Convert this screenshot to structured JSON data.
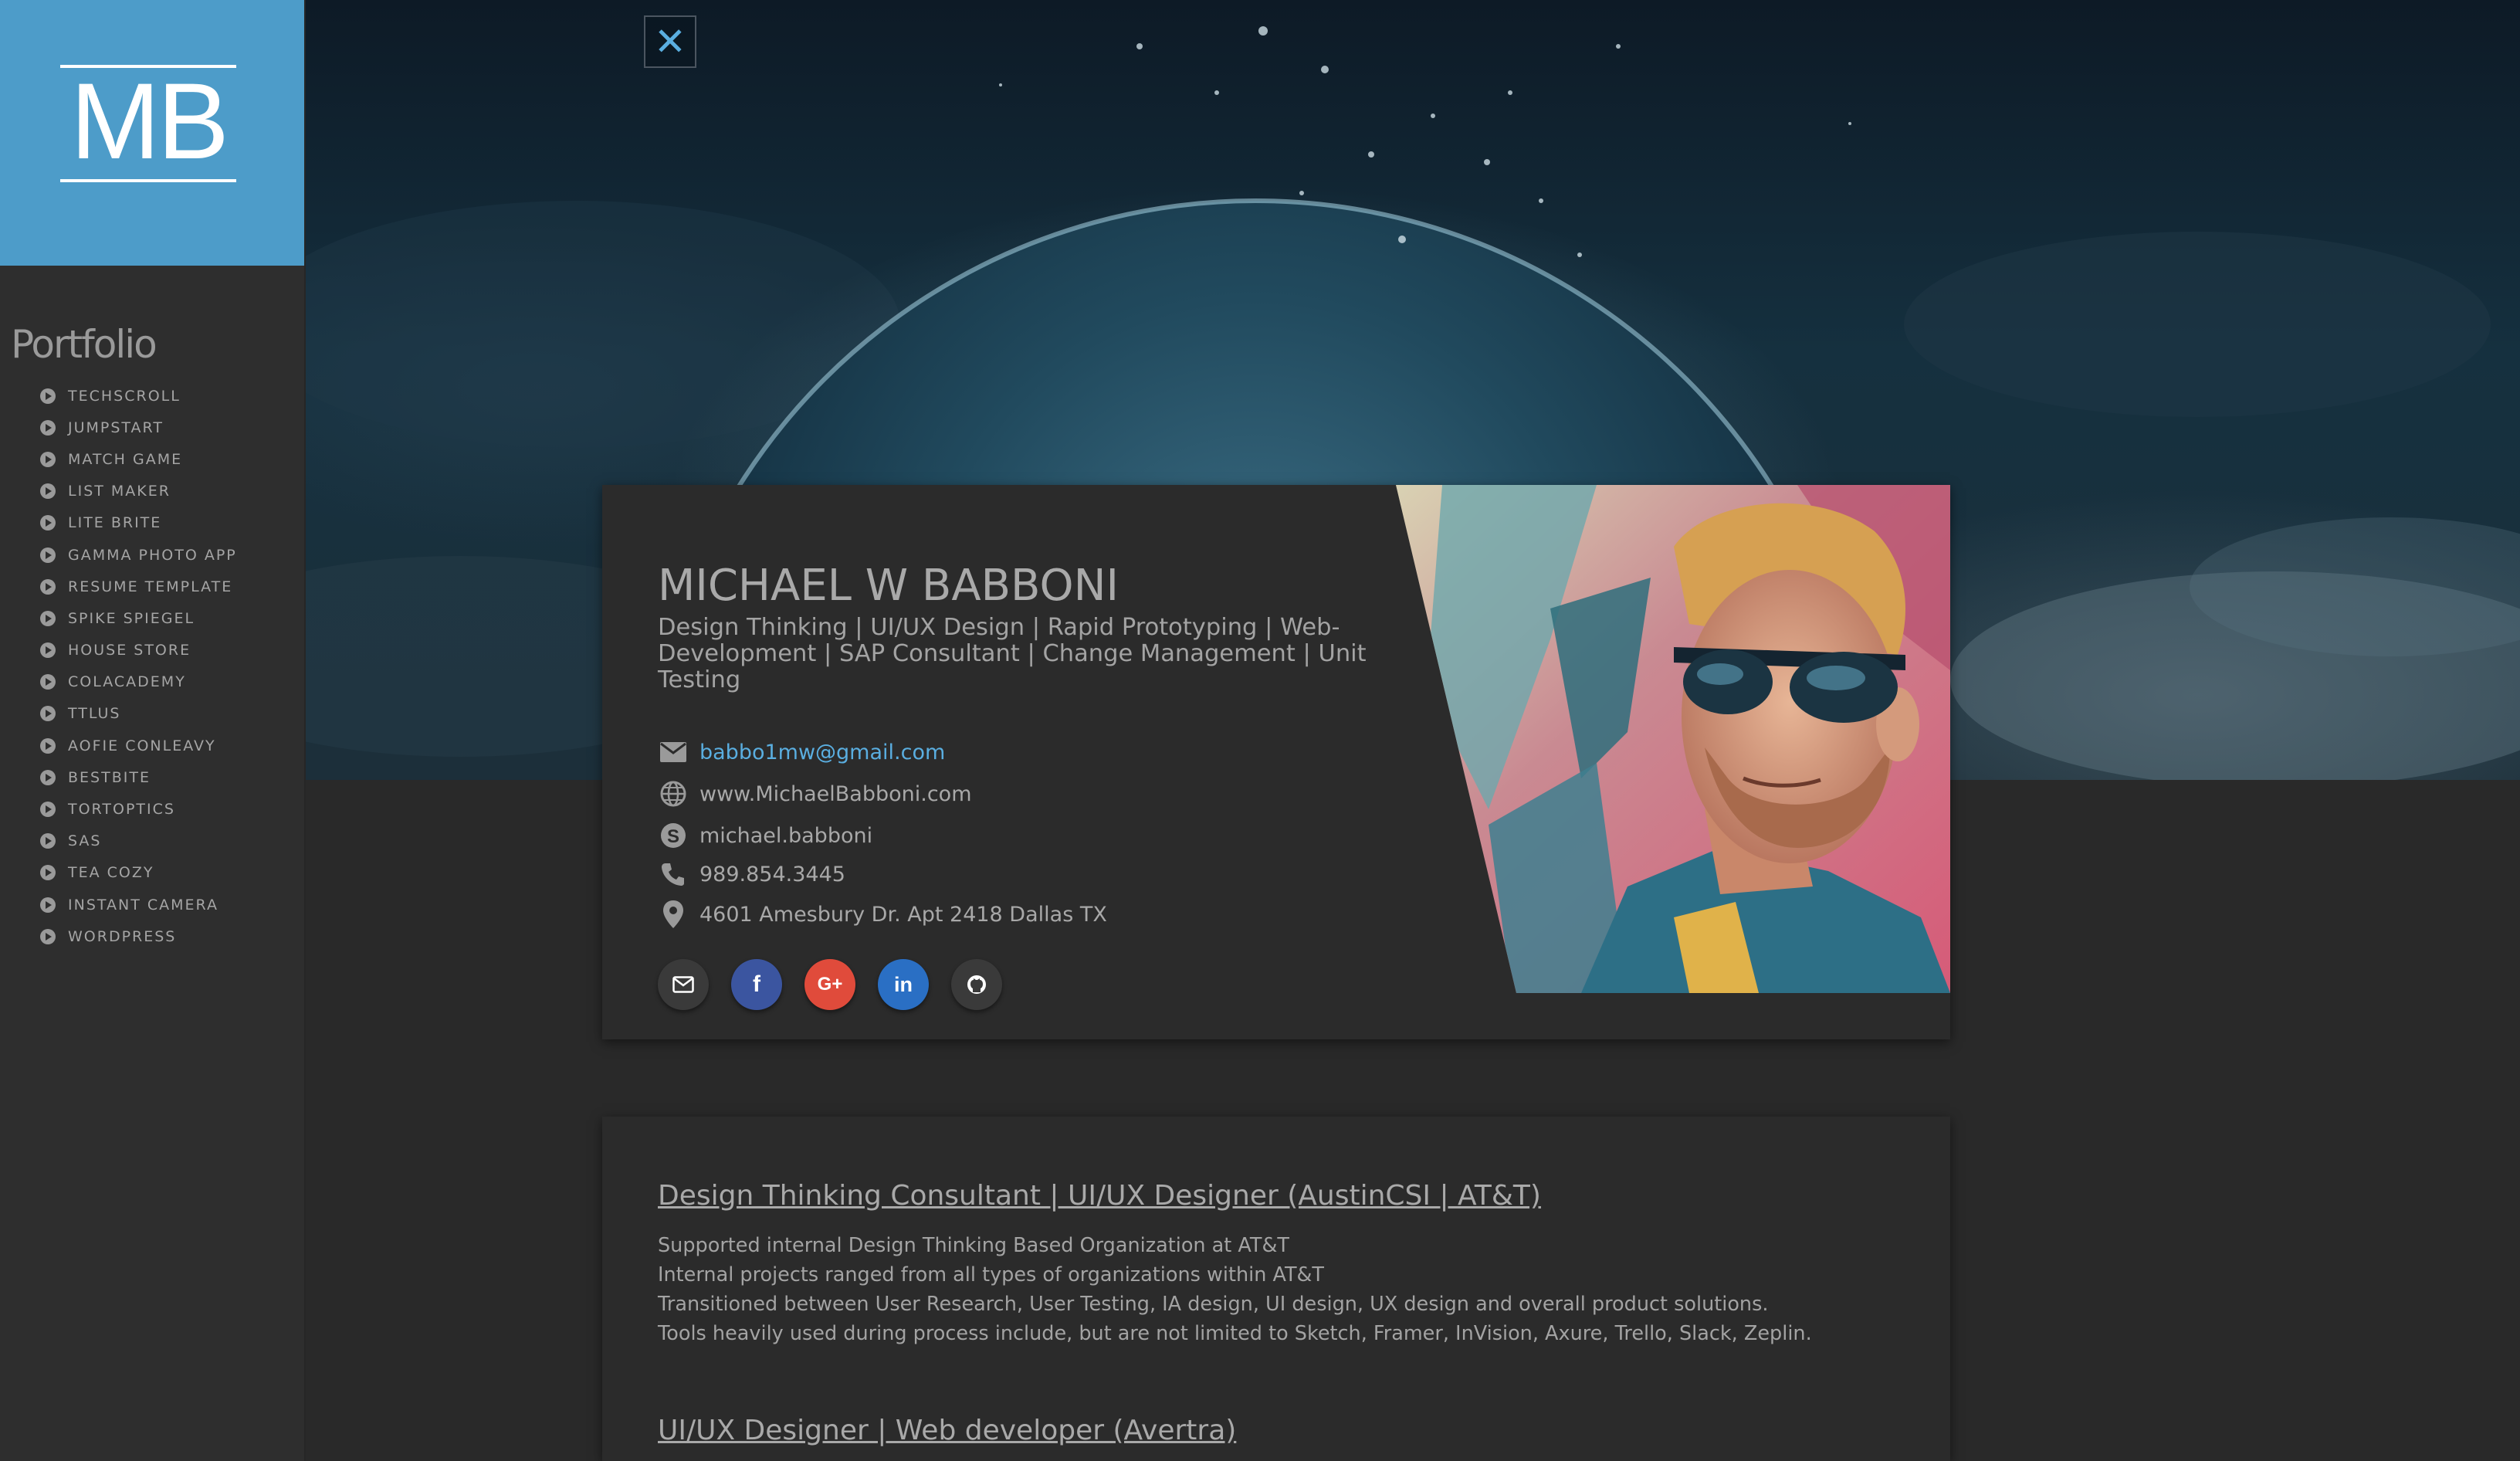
{
  "logo": {
    "text": "MB",
    "background": "#4d9cc9"
  },
  "sidebar": {
    "heading": "Portfolio",
    "items": [
      {
        "label": "TECHSCROLL"
      },
      {
        "label": "JUMPSTART"
      },
      {
        "label": "MATCH GAME"
      },
      {
        "label": "LIST MAKER"
      },
      {
        "label": "LITE BRITE"
      },
      {
        "label": "GAMMA PHOTO APP"
      },
      {
        "label": "RESUME TEMPLATE"
      },
      {
        "label": "SPIKE SPIEGEL"
      },
      {
        "label": "HOUSE STORE"
      },
      {
        "label": "COLACADEMY"
      },
      {
        "label": "TTLUS"
      },
      {
        "label": "AOFIE CONLEAVY"
      },
      {
        "label": "BESTBITE"
      },
      {
        "label": "TORTOPTICS"
      },
      {
        "label": "SAS"
      },
      {
        "label": "TEA COZY"
      },
      {
        "label": "INSTANT CAMERA"
      },
      {
        "label": "WORDPRESS"
      }
    ]
  },
  "hero": {
    "close_icon": "close-icon",
    "close_glyph": "✕"
  },
  "profile": {
    "name": "MICHAEL W BABBONI",
    "tagline": "Design Thinking | UI/UX Design | Rapid Prototyping | Web-Development | SAP Consultant | Change Management | Unit Testing",
    "contacts": {
      "email": "babbo1mw@gmail.com",
      "website": "www.MichaelBabboni.com",
      "skype": "michael.babboni",
      "phone": "989.854.3445",
      "address": "4601 Amesbury Dr. Apt 2418 Dallas TX"
    },
    "social": [
      {
        "icon": "mail-icon",
        "color": "#3a3a3a"
      },
      {
        "icon": "facebook-icon",
        "color": "#3b55a0"
      },
      {
        "icon": "google-plus-icon",
        "color": "#e04b3b"
      },
      {
        "icon": "linkedin-icon",
        "color": "#2a6fc4"
      },
      {
        "icon": "github-icon",
        "color": "#3a3a3a"
      }
    ],
    "social_glyphs": {
      "facebook": "f",
      "google": "G+",
      "linkedin": "in"
    }
  },
  "experience": {
    "jobs": [
      {
        "title": "Design Thinking Consultant | UI/UX Designer (AustinCSI | AT&T)",
        "lines": [
          "Supported internal Design Thinking Based Organization at AT&T",
          "Internal projects ranged from all types of organizations within AT&T",
          "Transitioned between User Research, User Testing, IA design, UI design, UX design and overall product solutions.",
          "Tools heavily used during process include, but are not limited to Sketch, Framer, InVision, Axure, Trello, Slack, Zeplin."
        ]
      },
      {
        "title": "UI/UX Designer | Web developer (Avertra)"
      }
    ]
  },
  "colors": {
    "accent": "#5aaee0",
    "sidebar_bg": "#2e2e2e",
    "card_bg": "#2b2b2b",
    "text_muted": "#a5a5a5"
  }
}
